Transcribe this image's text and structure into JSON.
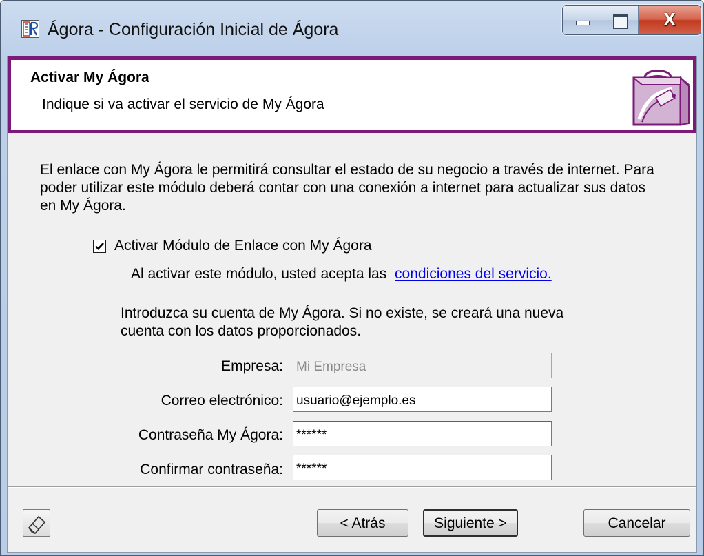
{
  "window": {
    "title": "Ágora - Configuración Inicial de Ágora",
    "close_glyph": "X"
  },
  "header": {
    "title": "Activar My Ágora",
    "subtitle": "Indique si va activar el servicio de My Ágora",
    "accent_color": "#7b1a78",
    "icon": "shopping-bag-icon"
  },
  "body": {
    "intro": "El enlace con My Ágora le permitirá consultar el estado de su negocio a través de internet. Para poder utilizar este módulo deberá contar con una conexión a internet para actualizar sus datos en My Ágora.",
    "checkbox": {
      "label": "Activar Módulo de Enlace con My Ágora",
      "checked": true
    },
    "accept_text": "Al activar este módulo, usted acepta las",
    "accept_link": "condiciones del servicio.",
    "account_text": "Introduzca su cuenta de My Ágora. Si no existe, se creará una nueva cuenta con los datos proporcionados."
  },
  "form": {
    "empresa": {
      "label": "Empresa:",
      "value": "Mi Empresa",
      "enabled": false
    },
    "correo": {
      "label": "Correo electrónico:",
      "value": "usuario@ejemplo.es"
    },
    "contrasena": {
      "label": "Contraseña My Ágora:",
      "value": "******"
    },
    "confirmar": {
      "label": "Confirmar contraseña:",
      "value": "******"
    }
  },
  "footer": {
    "help_icon": "eraser-icon",
    "back_label": "< Atrás",
    "next_label": "Siguiente >",
    "cancel_label": "Cancelar"
  }
}
